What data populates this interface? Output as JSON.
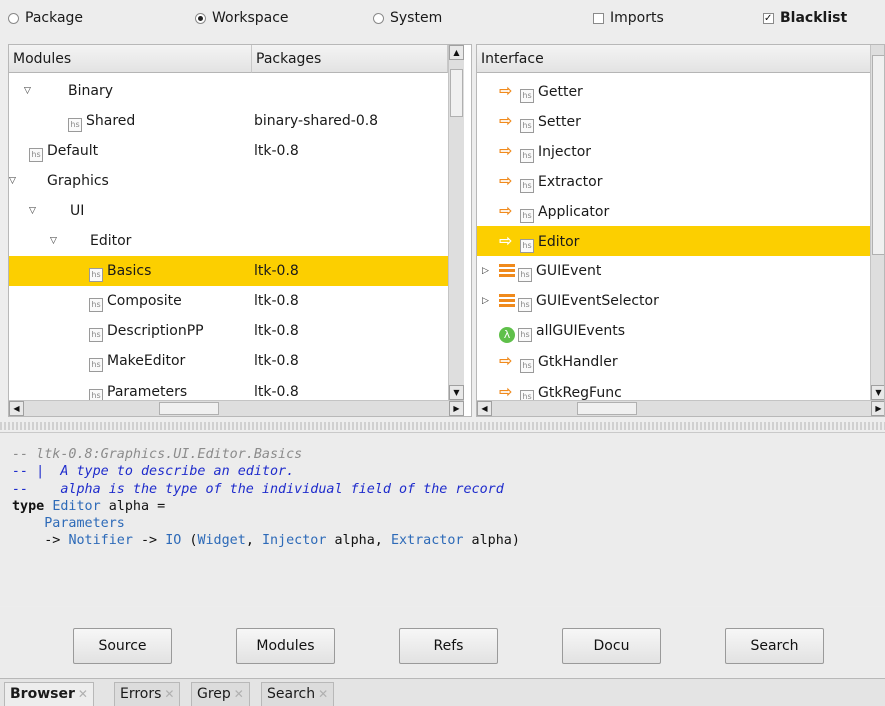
{
  "options": {
    "package": "Package",
    "workspace": "Workspace",
    "system": "System",
    "imports": "Imports",
    "blacklist": "Blacklist",
    "selected_scope": "Workspace",
    "imports_checked": false,
    "blacklist_checked": true
  },
  "modules": {
    "col_modules": "Modules",
    "col_packages": "Packages",
    "rows": [
      {
        "name": "Binary",
        "package": ""
      },
      {
        "name": "Shared",
        "package": "binary-shared-0.8"
      },
      {
        "name": "Default",
        "package": "ltk-0.8"
      },
      {
        "name": "Graphics",
        "package": ""
      },
      {
        "name": "UI",
        "package": ""
      },
      {
        "name": "Editor",
        "package": ""
      },
      {
        "name": "Basics",
        "package": "ltk-0.8"
      },
      {
        "name": "Composite",
        "package": "ltk-0.8"
      },
      {
        "name": "DescriptionPP",
        "package": "ltk-0.8"
      },
      {
        "name": "MakeEditor",
        "package": "ltk-0.8"
      },
      {
        "name": "Parameters",
        "package": "ltk-0.8"
      }
    ]
  },
  "interface": {
    "header": "Interface",
    "items": [
      {
        "name": "Getter",
        "icon": "arrow-icon"
      },
      {
        "name": "Setter",
        "icon": "arrow-icon"
      },
      {
        "name": "Injector",
        "icon": "arrow-icon"
      },
      {
        "name": "Extractor",
        "icon": "arrow-icon"
      },
      {
        "name": "Applicator",
        "icon": "arrow-icon"
      },
      {
        "name": "Editor",
        "icon": "arrow-icon"
      },
      {
        "name": "GUIEvent",
        "icon": "data-type-icon"
      },
      {
        "name": "GUIEventSelector",
        "icon": "data-type-icon"
      },
      {
        "name": "allGUIEvents",
        "icon": "lambda-icon"
      },
      {
        "name": "GtkHandler",
        "icon": "arrow-icon"
      },
      {
        "name": "GtkRegFunc",
        "icon": "arrow-icon"
      }
    ]
  },
  "hs_label": "hs",
  "source": {
    "line1": "-- ltk-0.8:Graphics.UI.Editor.Basics",
    "line2": "-- |  A type to describe an editor.",
    "line3": "--    alpha is the type of the individual field of the record",
    "kw_type": "type",
    "t_editor": "Editor",
    "t_alpha_eq": " alpha =",
    "t_parameters": "Parameters",
    "arrow1": "-> ",
    "t_notifier": "Notifier",
    "arrow2": " -> ",
    "t_io": "IO",
    "paren_open": " (",
    "t_widget": "Widget",
    "comma1": ", ",
    "t_injector": "Injector",
    "alpha_comma": " alpha, ",
    "t_extractor": "Extractor",
    "alpha_close": " alpha)"
  },
  "buttons": {
    "source": "Source",
    "modules": "Modules",
    "refs": "Refs",
    "docu": "Docu",
    "search": "Search"
  },
  "tabs": {
    "browser": "Browser",
    "errors": "Errors",
    "grep": "Grep",
    "search": "Search"
  },
  "colors": {
    "selection": "#fccf00",
    "arrow": "#f08a1c",
    "lambda": "#5fc04a",
    "doc_comment": "#1f2ccc",
    "type_name": "#2d6ab8"
  }
}
